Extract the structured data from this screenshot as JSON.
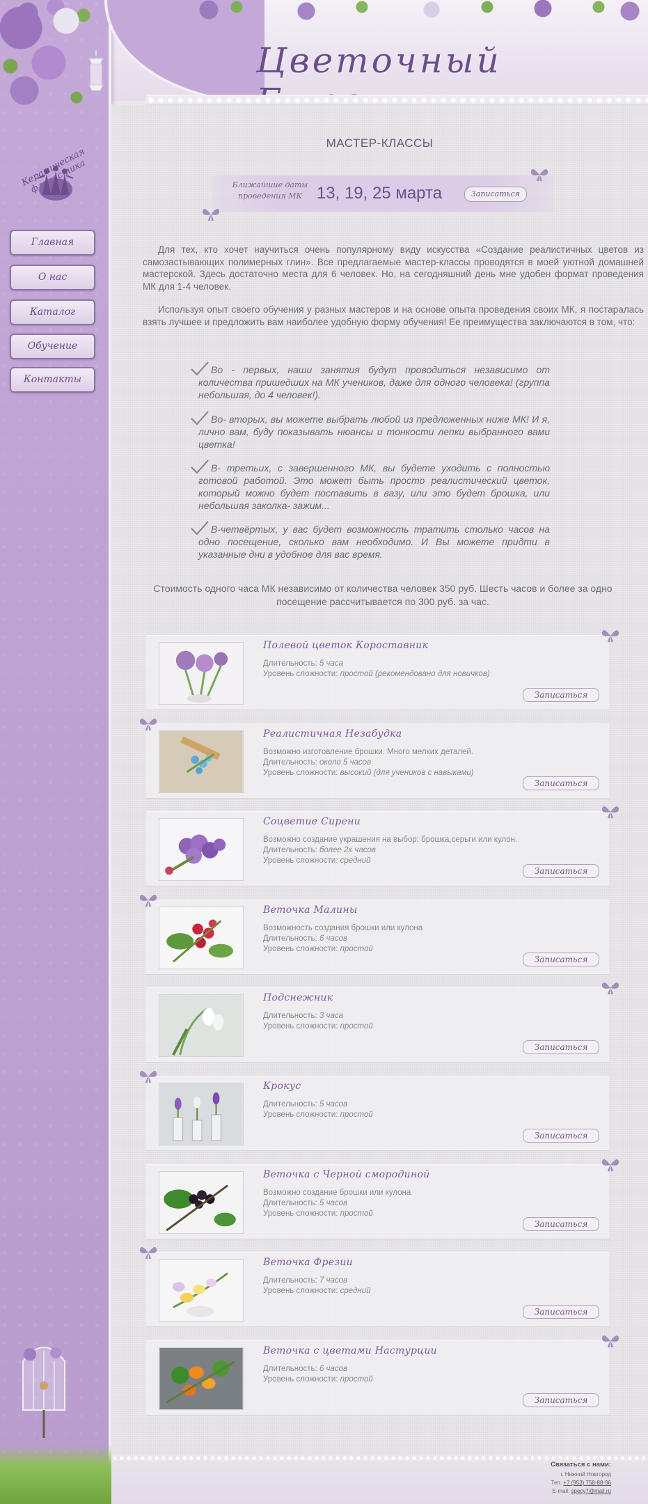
{
  "site": {
    "title": "Цветочный Блюз"
  },
  "sidebar": {
    "logo_text": "Керамическая флористика",
    "nav": [
      {
        "label": "Главная"
      },
      {
        "label": "О нас"
      },
      {
        "label": "Каталог"
      },
      {
        "label": "Обучение"
      },
      {
        "label": "Контакты"
      }
    ]
  },
  "main": {
    "page_title": "МАСТЕР-КЛАССЫ",
    "dates": {
      "label": "Ближайшие даты проведения МК",
      "value": "13, 19, 25 марта",
      "signup": "Записаться"
    },
    "intro": [
      "Для тех, кто хочет научиться очень популярному виду искусства «Создание реалистичных цветов из самозастывающих полимерных глин». Все предлагаемые мастер-классы проводятся в моей уютной домашней мастерской. Здесь достаточно места для 6 человек. Но, на сегодняшний день мне удобен формат проведения МК для 1-4 человек.",
      "Используя опыт своего обучения у разных мастеров и на основе опыта проведения своих МК, я постаралась взять лучшее и предложить вам наиболее удобную форму обучения! Ее преимущества заключаются в том, что:"
    ],
    "bullets": [
      "Во - первых, наши занятия будут проводиться независимо от количества пришедших на МК учеников, даже для одного человека! (группа небольшая, до 4 человек!).",
      "Во- вторых, вы можете выбрать любой из предложенных ниже МК! И я, лично вам, буду показывать нюансы и тонкости лепки выбранного вами цветка!",
      "В- третьих, с завершенного МК, вы будете уходить с полностью готовой работой. Это может быть просто реалистический цветок, который можно будет поставить в вазу, или это будет брошка, или небольшая заколка- зажим...",
      "В-четвёртых, у вас будет возможность тратить столько часов на одно посещение, сколько вам необходимо. И Вы можете придти в указанные дни в удобное для вас время."
    ],
    "price": "Стоимость одного часа МК независимо от количества человек 350 руб. Шесть часов и более за одно посещение рассчитывается по 300 руб. за час.",
    "courses": [
      {
        "title": "Полевой цветок Короставник",
        "desc": "",
        "duration_label": "Длительность:",
        "duration": "5 часа",
        "level_label": "Уровень сложности:",
        "level": "простой (рекомендовано для новичков)",
        "signup": "Записаться",
        "thumb": "purple-knapweed"
      },
      {
        "title": "Реалистичная Незабудка",
        "desc": "Возможно изготовление брошки. Много мелких деталей.",
        "duration_label": "Длительность:",
        "duration": "около 5 часов",
        "level_label": "Уровень сложности:",
        "level": "высокий (для учеников с навыками)",
        "signup": "Записаться",
        "thumb": "blue-forget-me-not"
      },
      {
        "title": "Соцветие Сирени",
        "desc": "Возможно создание украшения на выбор: брошка,серьги или кулон.",
        "duration_label": "Длительность:",
        "duration": "более 2х часов",
        "level_label": "Уровень сложности:",
        "level": "средний",
        "signup": "Записаться",
        "thumb": "lilac-cluster"
      },
      {
        "title": "Веточка Малины",
        "desc": "Возможность создания брошки или кулона",
        "duration_label": "Длительность:",
        "duration": "6 часов",
        "level_label": "Уровень сложности:",
        "level": "простой",
        "signup": "Записаться",
        "thumb": "raspberry-branch"
      },
      {
        "title": "Подснежник",
        "desc": "",
        "duration_label": "Длительность:",
        "duration": "3 часа",
        "level_label": "Уровень сложности:",
        "level": "простой",
        "signup": "Записаться",
        "thumb": "snowdrop"
      },
      {
        "title": "Крокус",
        "desc": "",
        "duration_label": "Длительность:",
        "duration": "5 часов",
        "level_label": "Уровень сложности:",
        "level": "простой",
        "signup": "Записаться",
        "thumb": "crocus"
      },
      {
        "title": "Веточка с Черной смородиной",
        "desc": "Возможно создание брошки или кулона",
        "duration_label": "Длительность:",
        "duration": "5 часов",
        "level_label": "Уровень сложности:",
        "level": "простой",
        "signup": "Записаться",
        "thumb": "blackcurrant-branch"
      },
      {
        "title": "Веточка Фрезии",
        "desc": "",
        "duration_label": "Длительность:",
        "duration": "7 часов",
        "level_label": "Уровень сложности:",
        "level": "средний",
        "signup": "Записаться",
        "thumb": "freesia-branch"
      },
      {
        "title": "Веточка с цветами Настурции",
        "desc": "",
        "duration_label": "Длительность:",
        "duration": "6 часов",
        "level_label": "Уровень сложности:",
        "level": "простой",
        "signup": "Записаться",
        "thumb": "nasturtium-branch"
      }
    ]
  },
  "footer": {
    "heading": "Связаться с нами:",
    "city": "г. Нижний Новгород",
    "phone_label": "Тел.",
    "phone": "+7 (953) 758-88-96",
    "email_label": "E-mail:",
    "email": "specy7@mail.ru"
  },
  "colors": {
    "accent": "#6e4d91",
    "sidebar": "#bea2d3",
    "background": "#e5e3e6"
  }
}
